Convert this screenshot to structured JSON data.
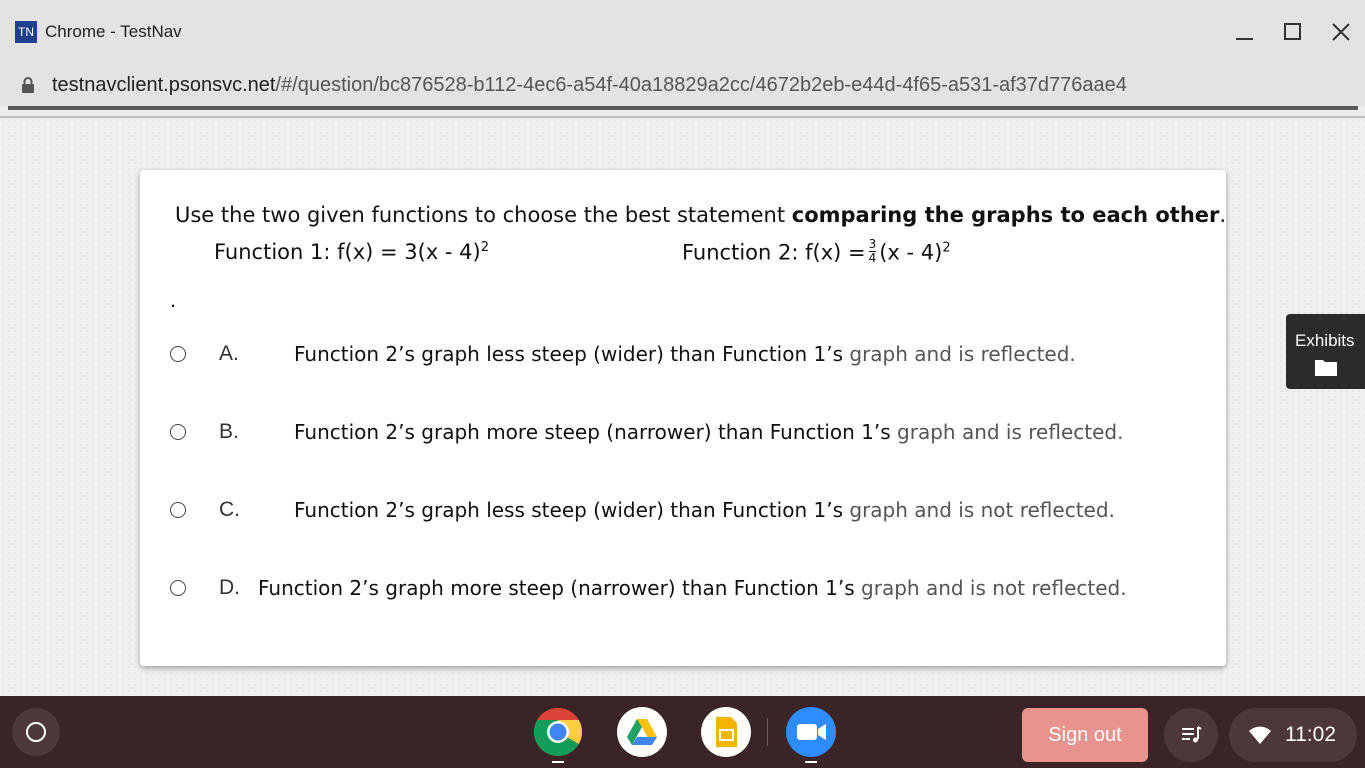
{
  "window": {
    "badge": "TN",
    "title": "Chrome - TestNav"
  },
  "address_bar": {
    "host": "testnavclient.psonsvc.net",
    "path": "/#/question/bc876528-b112-4ec6-a54f-40a18829a2cc/4672b2eb-e44d-4f65-a531-af37d776aae4"
  },
  "question": {
    "prompt_plain": "Use the two given functions to choose the best statement ",
    "prompt_bold": "comparing the graphs to each other",
    "prompt_end": ".",
    "function1_label": "Function 1: ",
    "function1_expr": "f(x) = 3(x - 4)",
    "function1_exp": "2",
    "function2_label": "Function 2: f(x) =",
    "function2_num": "3",
    "function2_den": "4",
    "function2_expr": "(x - 4)",
    "function2_exp": "2",
    "stray_mark": "."
  },
  "options": [
    {
      "letter": "A.",
      "text": "Function 2’s graph less steep (wider) than Function 1’s ",
      "muted": "graph and is reflected."
    },
    {
      "letter": "B.",
      "text": "Function 2’s graph more steep (narrower) than Function 1’s ",
      "muted": "graph and is reflected."
    },
    {
      "letter": "C.",
      "text": "Function 2’s graph less steep (wider) than Function 1’s ",
      "muted": "graph and is not reflected."
    },
    {
      "letter": "D.",
      "text": "Function 2’s graph more steep (narrower) than Function 1’s ",
      "muted": "graph and is not reflected."
    }
  ],
  "exhibits": {
    "label": "Exhibits",
    "icon": "folder-icon"
  },
  "shelf": {
    "apps": [
      "chrome-icon",
      "google-drive-icon",
      "google-slides-icon",
      "zoom-icon"
    ],
    "sign_out": "Sign out",
    "time": "11:02"
  }
}
